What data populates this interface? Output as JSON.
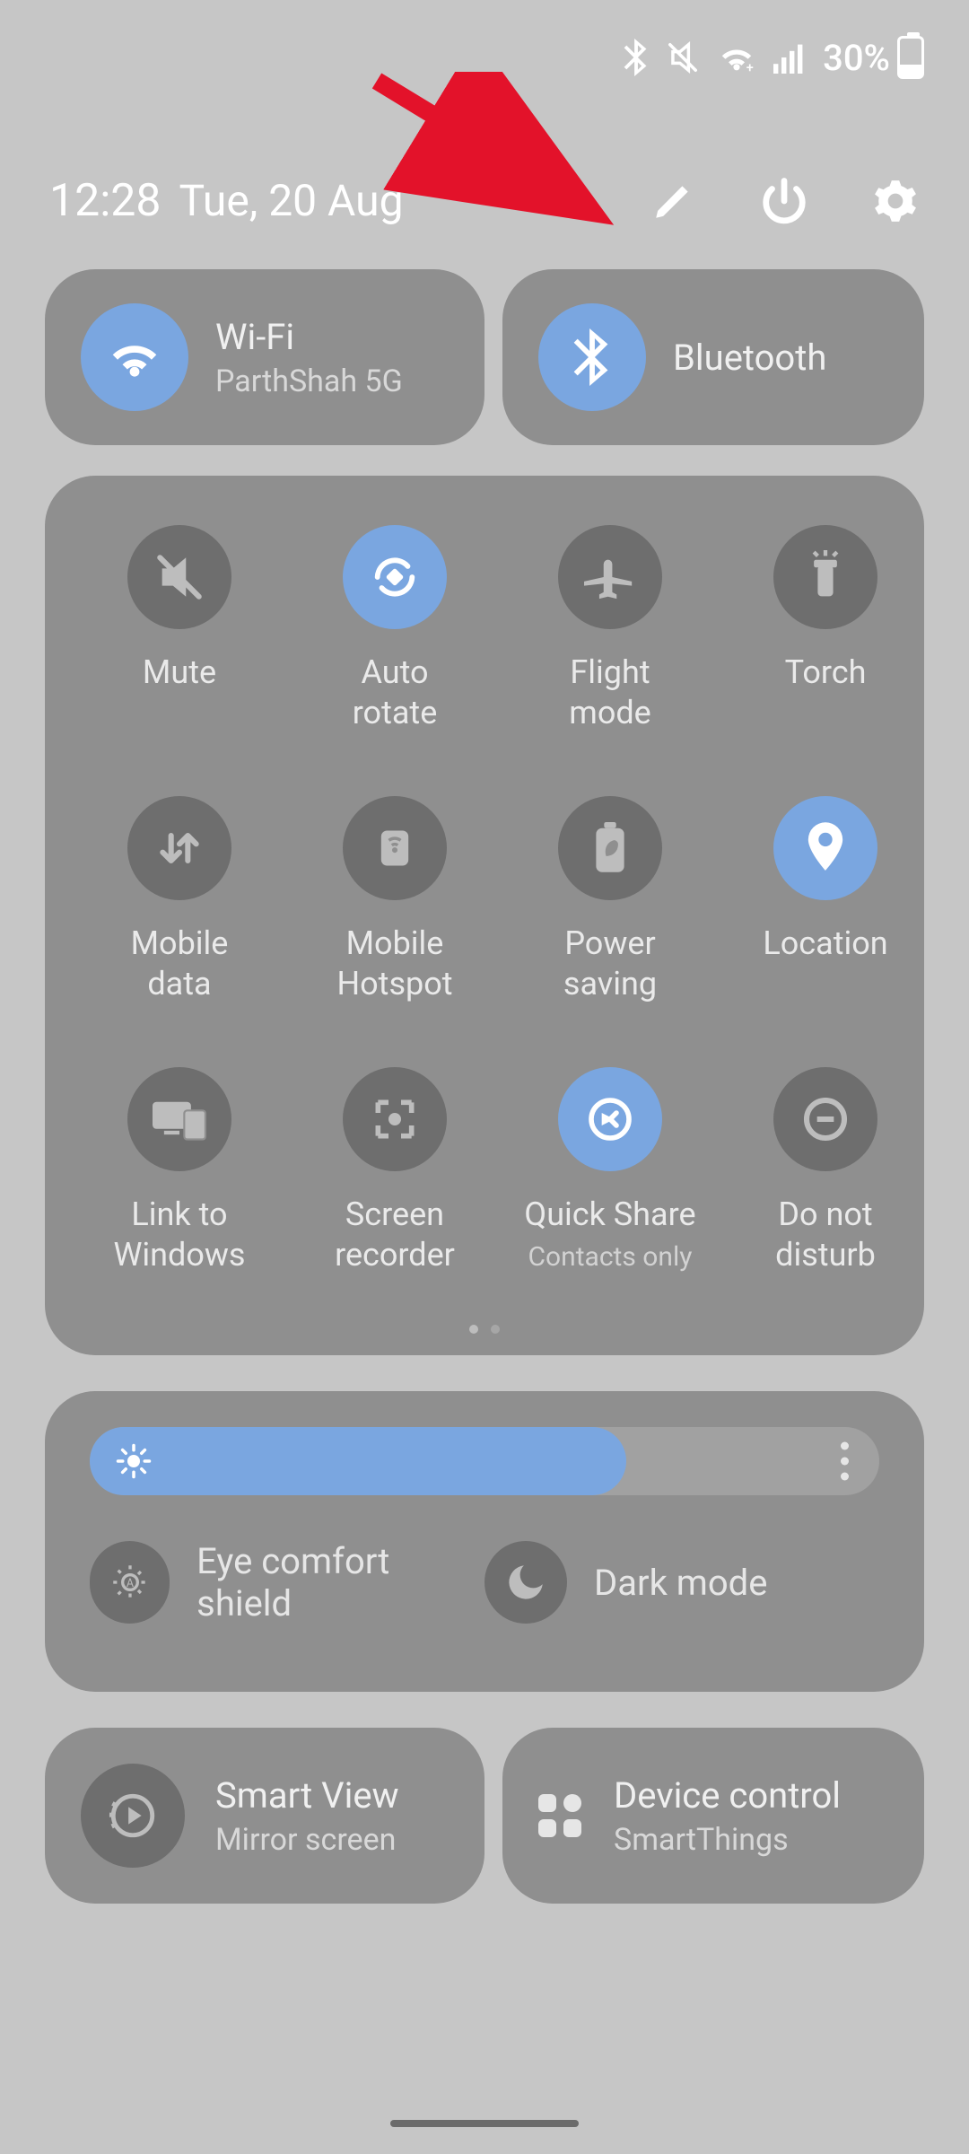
{
  "status": {
    "battery_pct": "30%"
  },
  "header": {
    "time": "12:28",
    "date": "Tue, 20 Aug"
  },
  "tiles": {
    "wifi": {
      "title": "Wi-Fi",
      "subtitle": "ParthShah 5G",
      "active": true
    },
    "bt": {
      "title": "Bluetooth",
      "active": true
    }
  },
  "grid": [
    {
      "id": "mute",
      "label": "Mute",
      "active": false,
      "icon": "mute"
    },
    {
      "id": "autorotate",
      "label": "Auto\nrotate",
      "active": true,
      "icon": "rotate"
    },
    {
      "id": "flight",
      "label": "Flight\nmode",
      "active": false,
      "icon": "plane"
    },
    {
      "id": "torch",
      "label": "Torch",
      "active": false,
      "icon": "torch"
    },
    {
      "id": "mobiledata",
      "label": "Mobile\ndata",
      "active": false,
      "icon": "updown"
    },
    {
      "id": "hotspot",
      "label": "Mobile\nHotspot",
      "active": false,
      "icon": "hotspot"
    },
    {
      "id": "powersave",
      "label": "Power\nsaving",
      "active": false,
      "icon": "battery-leaf"
    },
    {
      "id": "location",
      "label": "Location",
      "active": true,
      "icon": "pin"
    },
    {
      "id": "linkwin",
      "label": "Link to\nWindows",
      "active": false,
      "icon": "devices"
    },
    {
      "id": "recorder",
      "label": "Screen\nrecorder",
      "active": false,
      "icon": "recorder"
    },
    {
      "id": "quickshare",
      "label": "Quick Share",
      "sub": "Contacts only",
      "active": true,
      "icon": "share"
    },
    {
      "id": "dnd",
      "label": "Do not\ndisturb",
      "active": false,
      "icon": "minus"
    }
  ],
  "brightness": {
    "value_pct": 68,
    "eye": {
      "label": "Eye comfort shield",
      "active": false
    },
    "dark": {
      "label": "Dark mode",
      "active": false
    }
  },
  "bottom": {
    "smartview": {
      "title": "Smart View",
      "subtitle": "Mirror screen"
    },
    "device": {
      "title": "Device control",
      "subtitle": "SmartThings"
    }
  }
}
